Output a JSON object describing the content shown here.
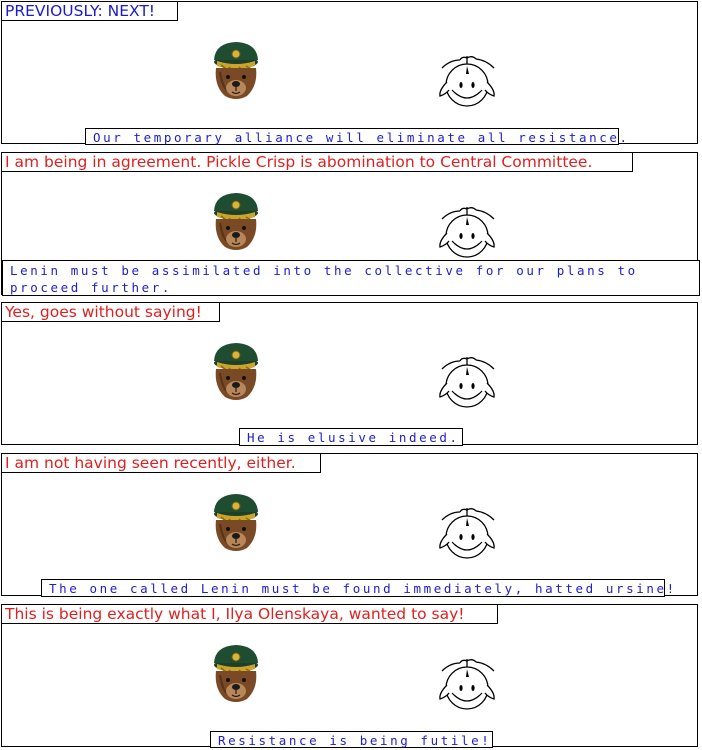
{
  "panels": [
    {
      "speaker1_text": "PREVIOUSLY: NEXT!",
      "speaker2_text": "Our temporary alliance will eliminate all resistance."
    },
    {
      "speaker1_text": "I am being in agreement.  Pickle Crisp is abomination to Central Committee.",
      "speaker2_text": "Lenin must be assimilated into the collective for our plans to proceed further."
    },
    {
      "speaker1_text": "Yes, goes without saying!",
      "speaker2_text": "He is elusive indeed."
    },
    {
      "speaker1_text": "I am not having seen recently, either.",
      "speaker2_text": "The one called Lenin must be found immediately, hatted ursine!"
    },
    {
      "speaker1_text": "This is being exactly what I, Ilya Olenskaya, wanted to say!",
      "speaker2_text": "Resistance is being futile!"
    }
  ],
  "colors": {
    "bear_caption": "#e02020",
    "header_caption": "#1a1ad0",
    "lemming_caption": "#2020c8",
    "border": "#000000"
  },
  "icons": [
    "bear-general-icon",
    "lemming-icon"
  ]
}
